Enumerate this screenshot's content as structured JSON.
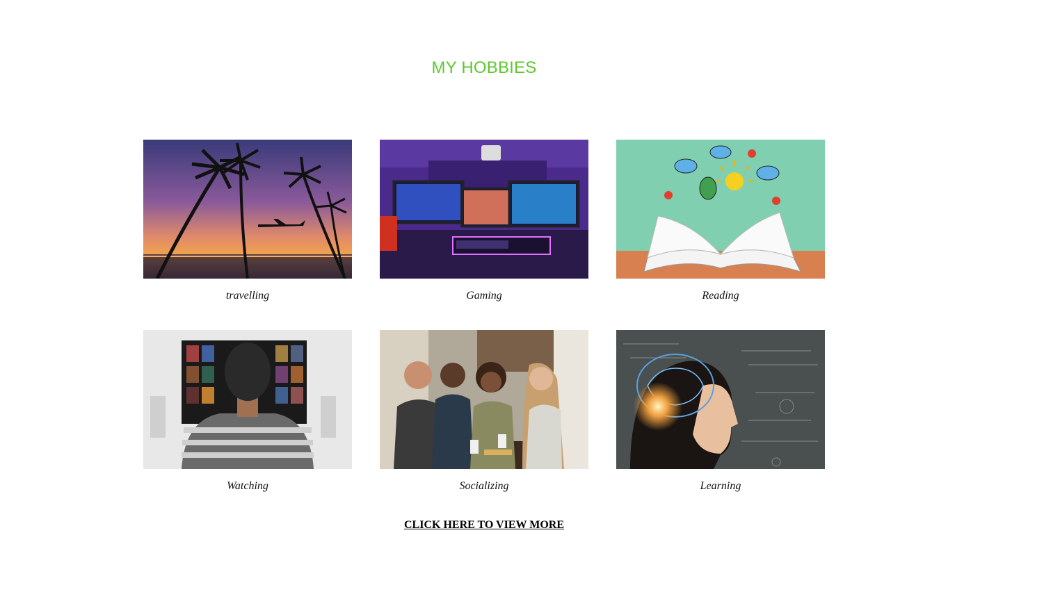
{
  "header": {
    "title": "MY HOBBIES"
  },
  "colors": {
    "title": "#5cc82f"
  },
  "hobbies": [
    {
      "caption": "travelling",
      "image": "sunset-palms-airplane"
    },
    {
      "caption": "Gaming",
      "image": "gaming-setup-monitors"
    },
    {
      "caption": "Reading",
      "image": "open-book-doodles"
    },
    {
      "caption": "Watching",
      "image": "man-watching-tv"
    },
    {
      "caption": "Socializing",
      "image": "friends-at-table"
    },
    {
      "caption": "Learning",
      "image": "child-brain-formulas"
    }
  ],
  "footer": {
    "link_label": "CLICK HERE TO VIEW MORE"
  }
}
